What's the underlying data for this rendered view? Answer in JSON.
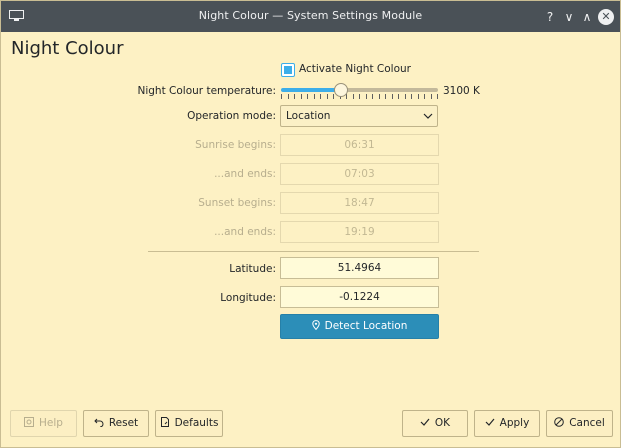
{
  "window": {
    "title": "Night Colour — System Settings Module",
    "controls": {
      "help": "?",
      "minimize": "∨",
      "maximize": "∧",
      "close": "✕"
    }
  },
  "page": {
    "heading": "Night Colour"
  },
  "activate": {
    "label": "Activate Night Colour",
    "checked": true
  },
  "temperature": {
    "label": "Night Colour temperature:",
    "value_text": "3100 K",
    "value": 3100
  },
  "mode": {
    "label": "Operation mode:",
    "selected": "Location"
  },
  "times": [
    {
      "label": "Sunrise begins:",
      "value": "06:31"
    },
    {
      "label": "...and ends:",
      "value": "07:03"
    },
    {
      "label": "Sunset begins:",
      "value": "18:47"
    },
    {
      "label": "...and ends:",
      "value": "19:19"
    }
  ],
  "location": {
    "latitude_label": "Latitude:",
    "latitude": "51.4964",
    "longitude_label": "Longitude:",
    "longitude": "-0.1224",
    "detect_label": "Detect Location"
  },
  "buttons": {
    "help": "Help",
    "reset": "Reset",
    "defaults": "Defaults",
    "ok": "OK",
    "apply": "Apply",
    "cancel": "Cancel"
  },
  "colors": {
    "accent": "#3daee9",
    "background": "#fdf1c4",
    "titlebar": "#4a5157",
    "primary_button": "#2c8eb8"
  }
}
